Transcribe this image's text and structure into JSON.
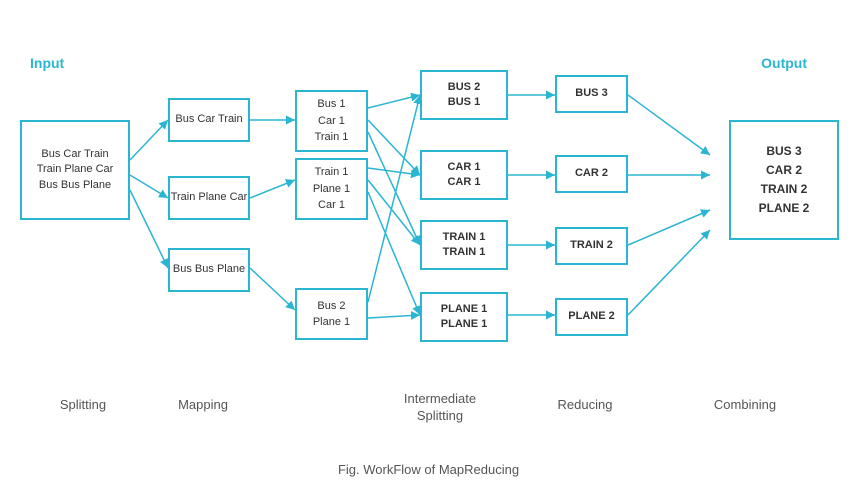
{
  "header": {
    "input_label": "Input",
    "output_label": "Output"
  },
  "boxes": {
    "input": {
      "text": "Bus Car Train\nTrain Plane Car\nBus Bus Plane"
    },
    "map1": {
      "text": "Bus Car Train"
    },
    "map2": {
      "text": "Train Plane Car"
    },
    "map3": {
      "text": "Bus Bus Plane"
    },
    "split1": {
      "text": "Bus 1\nCar 1\nTrain 1"
    },
    "split2": {
      "text": "Train 1\nPlane 1\nCar 1"
    },
    "split3": {
      "text": "Bus 2\nPlane 1"
    },
    "inter1": {
      "text": "BUS 2\nBUS 1"
    },
    "inter2": {
      "text": "CAR 1\nCAR 1"
    },
    "inter3": {
      "text": "TRAIN 1\nTRAIN 1"
    },
    "inter4": {
      "text": "PLANE 1\nPLANE 1"
    },
    "reduce1": {
      "text": "BUS 3"
    },
    "reduce2": {
      "text": "CAR 2"
    },
    "reduce3": {
      "text": "TRAIN 2"
    },
    "reduce4": {
      "text": "PLANE 2"
    },
    "output": {
      "text": "BUS 3\nCAR 2\nTRAIN 2\nPLANE 2"
    }
  },
  "labels": {
    "splitting": "Splitting",
    "mapping": "Mapping",
    "intermediate_splitting": "Intermediate\nSplitting",
    "reducing": "Reducing",
    "combining": "Combining"
  },
  "caption": "Fig. WorkFlow of MapReducing"
}
